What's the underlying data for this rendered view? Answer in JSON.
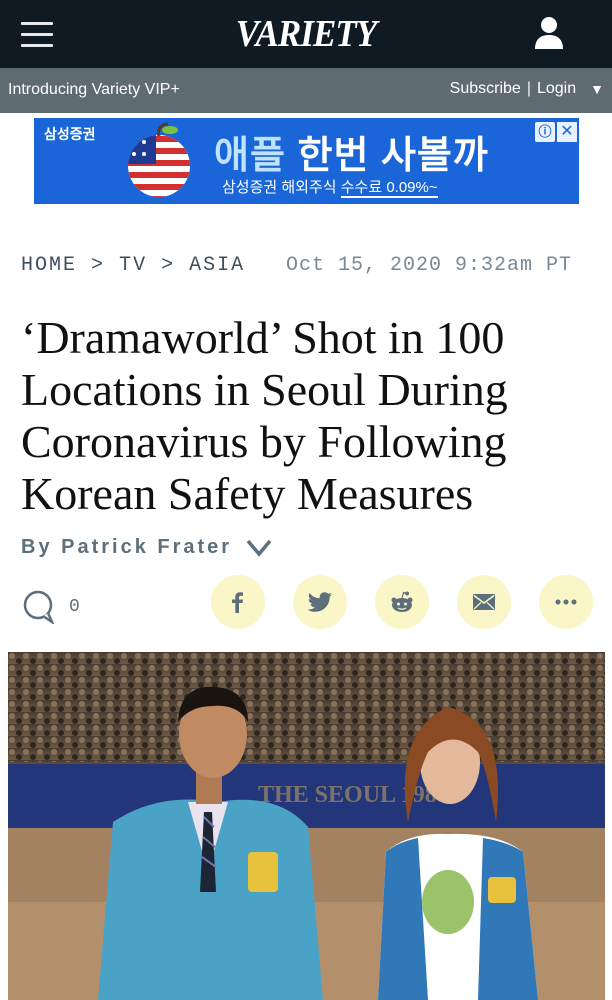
{
  "header": {
    "logo": "VARIETY",
    "menu_icon": "hamburger-menu-icon",
    "user_icon": "user-account-icon"
  },
  "subbar": {
    "vip": "Introducing Variety VIP+",
    "subscribe": "Subscribe",
    "separator": "|",
    "login": "Login",
    "caret": "▼"
  },
  "ad": {
    "brand": "삼성증권",
    "headline_part1": "애플",
    "headline_part2": " 한번 사볼까",
    "sub_part1": "삼성증권 해외주식 ",
    "sub_part2": "수수료 0.09%~",
    "choices_icon": "ⓘ",
    "close_icon": "✕"
  },
  "breadcrumb": {
    "home": "HOME",
    "arrow": ">",
    "tv": "TV",
    "asia": "ASIA"
  },
  "date": "Oct 15, 2020 9:32am PT",
  "headline": "‘Dramaworld’ Shot in 100 Locations in Seoul During Coronavirus by Following Korean Safety Measures",
  "byline": "By Patrick Frater",
  "comments": {
    "count": "0"
  },
  "share": {
    "facebook": "facebook-icon",
    "twitter": "twitter-icon",
    "reddit": "reddit-icon",
    "email": "email-icon",
    "more": "more-icon"
  },
  "hero": {
    "background_text": "THE SEOUL 1988"
  },
  "colors": {
    "nav": "#0f1a22",
    "subbar": "#5f6b73",
    "ad_blue": "#1a66d8",
    "highlight": "#fff176",
    "share_bg": "#fbf6c8"
  }
}
